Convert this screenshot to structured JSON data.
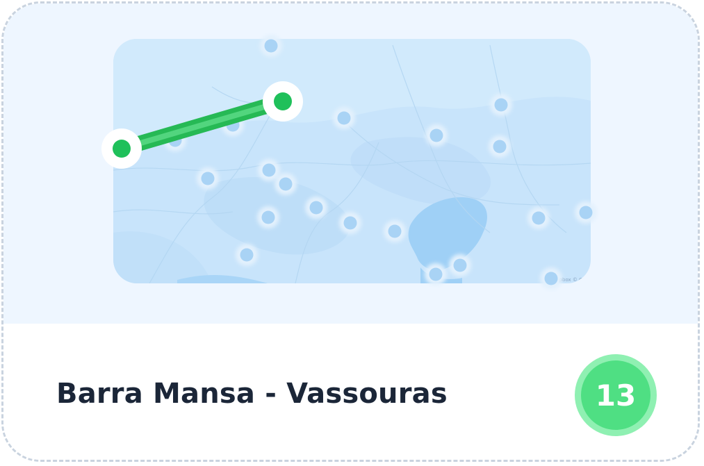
{
  "route": {
    "title": "Barra Mansa - Vassouras",
    "stop_count": "13"
  },
  "map": {
    "attribution": "© Mapbox © OpenStreetMap",
    "route_color": "#2cc25a",
    "marker_color": "#cce6fb"
  },
  "colors": {
    "card_border": "#c9d3df",
    "map_background": "#c8e4fb",
    "water": "#9fd0f6",
    "badge_outer": "#8ff0b2",
    "badge_inner": "#4fdf83",
    "title_text": "#1b2638"
  }
}
